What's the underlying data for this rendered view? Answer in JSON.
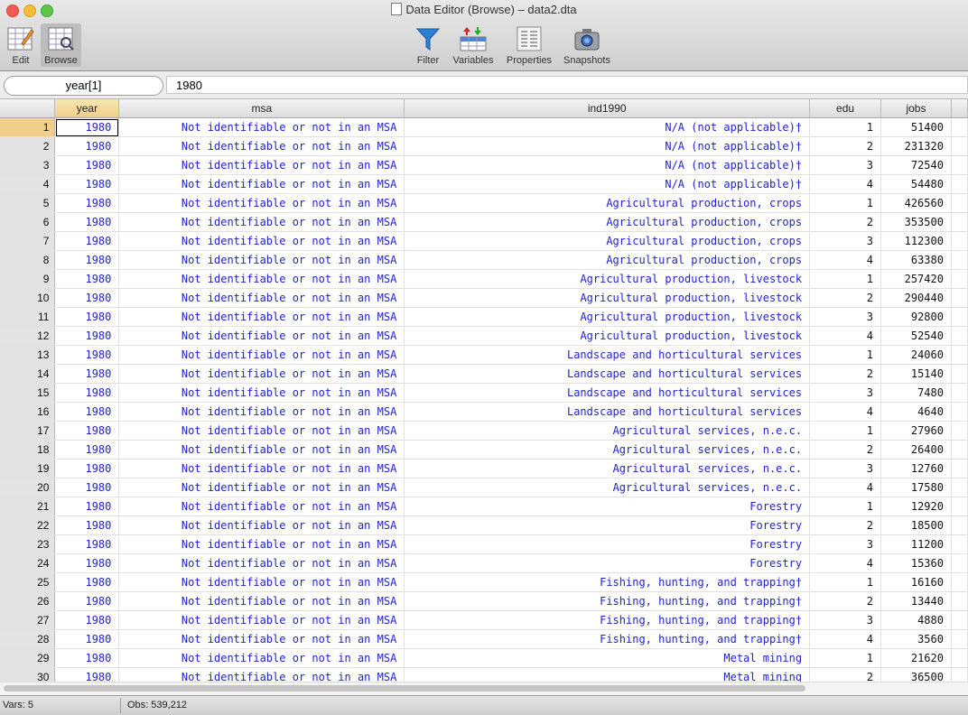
{
  "window": {
    "title": "Data Editor (Browse) – data2.dta"
  },
  "toolbar": {
    "edit_label": "Edit",
    "browse_label": "Browse",
    "filter_label": "Filter",
    "variables_label": "Variables",
    "properties_label": "Properties",
    "snapshots_label": "Snapshots"
  },
  "cellbar": {
    "varname": "year[1]",
    "value": "1980"
  },
  "columns": [
    "year",
    "msa",
    "ind1990",
    "edu",
    "jobs"
  ],
  "rows": [
    [
      "1",
      "1980",
      "Not identifiable or not in an MSA",
      "N/A (not applicable)†",
      "1",
      "51400"
    ],
    [
      "2",
      "1980",
      "Not identifiable or not in an MSA",
      "N/A (not applicable)†",
      "2",
      "231320"
    ],
    [
      "3",
      "1980",
      "Not identifiable or not in an MSA",
      "N/A (not applicable)†",
      "3",
      "72540"
    ],
    [
      "4",
      "1980",
      "Not identifiable or not in an MSA",
      "N/A (not applicable)†",
      "4",
      "54480"
    ],
    [
      "5",
      "1980",
      "Not identifiable or not in an MSA",
      "Agricultural production, crops",
      "1",
      "426560"
    ],
    [
      "6",
      "1980",
      "Not identifiable or not in an MSA",
      "Agricultural production, crops",
      "2",
      "353500"
    ],
    [
      "7",
      "1980",
      "Not identifiable or not in an MSA",
      "Agricultural production, crops",
      "3",
      "112300"
    ],
    [
      "8",
      "1980",
      "Not identifiable or not in an MSA",
      "Agricultural production, crops",
      "4",
      "63380"
    ],
    [
      "9",
      "1980",
      "Not identifiable or not in an MSA",
      "Agricultural production, livestock",
      "1",
      "257420"
    ],
    [
      "10",
      "1980",
      "Not identifiable or not in an MSA",
      "Agricultural production, livestock",
      "2",
      "290440"
    ],
    [
      "11",
      "1980",
      "Not identifiable or not in an MSA",
      "Agricultural production, livestock",
      "3",
      "92800"
    ],
    [
      "12",
      "1980",
      "Not identifiable or not in an MSA",
      "Agricultural production, livestock",
      "4",
      "52540"
    ],
    [
      "13",
      "1980",
      "Not identifiable or not in an MSA",
      "Landscape and horticultural services",
      "1",
      "24060"
    ],
    [
      "14",
      "1980",
      "Not identifiable or not in an MSA",
      "Landscape and horticultural services",
      "2",
      "15140"
    ],
    [
      "15",
      "1980",
      "Not identifiable or not in an MSA",
      "Landscape and horticultural services",
      "3",
      "7480"
    ],
    [
      "16",
      "1980",
      "Not identifiable or not in an MSA",
      "Landscape and horticultural services",
      "4",
      "4640"
    ],
    [
      "17",
      "1980",
      "Not identifiable or not in an MSA",
      "Agricultural services, n.e.c.",
      "1",
      "27960"
    ],
    [
      "18",
      "1980",
      "Not identifiable or not in an MSA",
      "Agricultural services, n.e.c.",
      "2",
      "26400"
    ],
    [
      "19",
      "1980",
      "Not identifiable or not in an MSA",
      "Agricultural services, n.e.c.",
      "3",
      "12760"
    ],
    [
      "20",
      "1980",
      "Not identifiable or not in an MSA",
      "Agricultural services, n.e.c.",
      "4",
      "17580"
    ],
    [
      "21",
      "1980",
      "Not identifiable or not in an MSA",
      "Forestry",
      "1",
      "12920"
    ],
    [
      "22",
      "1980",
      "Not identifiable or not in an MSA",
      "Forestry",
      "2",
      "18500"
    ],
    [
      "23",
      "1980",
      "Not identifiable or not in an MSA",
      "Forestry",
      "3",
      "11200"
    ],
    [
      "24",
      "1980",
      "Not identifiable or not in an MSA",
      "Forestry",
      "4",
      "15360"
    ],
    [
      "25",
      "1980",
      "Not identifiable or not in an MSA",
      "Fishing, hunting, and trapping†",
      "1",
      "16160"
    ],
    [
      "26",
      "1980",
      "Not identifiable or not in an MSA",
      "Fishing, hunting, and trapping†",
      "2",
      "13440"
    ],
    [
      "27",
      "1980",
      "Not identifiable or not in an MSA",
      "Fishing, hunting, and trapping†",
      "3",
      "4880"
    ],
    [
      "28",
      "1980",
      "Not identifiable or not in an MSA",
      "Fishing, hunting, and trapping†",
      "4",
      "3560"
    ],
    [
      "29",
      "1980",
      "Not identifiable or not in an MSA",
      "Metal mining",
      "1",
      "21620"
    ],
    [
      "30",
      "1980",
      "Not identifiable or not in an MSA",
      "Metal mining",
      "2",
      "36500"
    ]
  ],
  "status": {
    "vars": "Vars: 5",
    "obs": "Obs: 539,212"
  },
  "colors": {
    "value_label_text": "#2222cc",
    "selected_header": "#f0cf88"
  },
  "icons": [
    "edit-icon",
    "browse-icon",
    "filter-icon",
    "variables-icon",
    "properties-icon",
    "snapshots-icon"
  ]
}
